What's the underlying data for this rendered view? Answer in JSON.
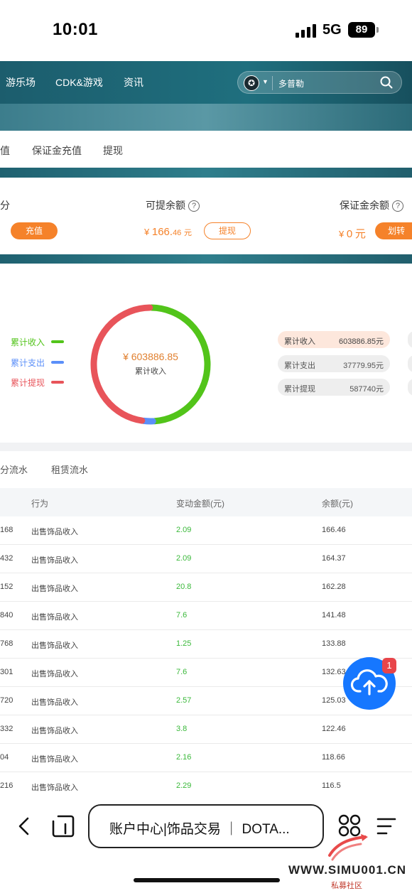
{
  "status_bar": {
    "time": "10:01",
    "network": "5G",
    "battery": "89"
  },
  "header": {
    "nav": [
      "游乐场",
      "CDK&游戏",
      "资讯"
    ],
    "search_text": "多普勒"
  },
  "account_tabs": [
    "值",
    "保证金充值",
    "提现"
  ],
  "balance": {
    "left_label_fragment": "分",
    "recharge_button": "充值",
    "withdrawable_label": "可提余额",
    "withdrawable_currency": "¥",
    "withdrawable_amount": "166.",
    "withdrawable_amount_decimal": "46",
    "withdrawable_unit": "元",
    "withdraw_button": "提现",
    "deposit_label": "保证金余额",
    "deposit_currency": "¥",
    "deposit_amount": "0",
    "deposit_unit": "元",
    "transfer_button": "划转",
    "help_icon_text": "?"
  },
  "summary": {
    "legend": [
      {
        "label": "累计收入",
        "color": "#52c41a"
      },
      {
        "label": "累计支出",
        "color": "#5b8ff9"
      },
      {
        "label": "累计提现",
        "color": "#e8545a"
      }
    ],
    "center_amount": "¥ 603886.85",
    "center_label": "累计收入",
    "pills": [
      {
        "label": "累计收入",
        "value": "603886.85元"
      },
      {
        "label": "累计支出",
        "value": "37779.95元"
      },
      {
        "label": "累计提现",
        "value": "587740元"
      }
    ],
    "shares": {
      "income": 603886.85,
      "expense": 37779.95,
      "withdraw": 587740
    }
  },
  "flow_tabs": [
    "分流水",
    "租赁流水"
  ],
  "table": {
    "headers": [
      "行为",
      "变动金额(元)",
      "余额(元)"
    ],
    "rows": [
      {
        "id": "168",
        "action": "出售饰品收入",
        "change": "2.09",
        "balance": "166.46"
      },
      {
        "id": "432",
        "action": "出售饰品收入",
        "change": "2.09",
        "balance": "164.37"
      },
      {
        "id": "152",
        "action": "出售饰品收入",
        "change": "20.8",
        "balance": "162.28"
      },
      {
        "id": "840",
        "action": "出售饰品收入",
        "change": "7.6",
        "balance": "141.48"
      },
      {
        "id": "768",
        "action": "出售饰品收入",
        "change": "1.25",
        "balance": "133.88"
      },
      {
        "id": "301",
        "action": "出售饰品收入",
        "change": "7.6",
        "balance": "132.63"
      },
      {
        "id": "720",
        "action": "出售饰品收入",
        "change": "2.57",
        "balance": "125.03"
      },
      {
        "id": "332",
        "action": "出售饰品收入",
        "change": "3.8",
        "balance": "122.46"
      },
      {
        "id": "04",
        "action": "出售饰品收入",
        "change": "2.16",
        "balance": "118.66"
      },
      {
        "id": "216",
        "action": "出售饰品收入",
        "change": "2.29",
        "balance": "116.5"
      }
    ]
  },
  "fab": {
    "badge": "1",
    "icon": "cloud-upload-icon"
  },
  "browser": {
    "address_text": "账户中心|饰品交易 ｜ DOTA..."
  },
  "watermark": {
    "url": "WWW.SIMU001.CN",
    "sub": "私募社区"
  },
  "colors": {
    "accent": "#f5822a",
    "header": "#1f6f7e",
    "positive": "#3bb93b",
    "fab": "#1677ff"
  }
}
